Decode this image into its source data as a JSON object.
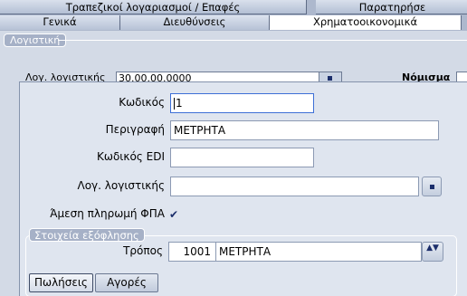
{
  "top_tabs": [
    "Τραπεζικοί λογαριασμοί / Επαφές",
    "Παρατηρήσε"
  ],
  "sub_tabs": [
    "Γενικά",
    "Διευθύνσεις",
    "Χρηματοοικονομικά"
  ],
  "active_sub_tab": "Χρηματοοικονομικά",
  "section_caption": "Λογιστική",
  "bg_account": {
    "label": "Λογ. λογιστικής",
    "value": "30.00.00.0000",
    "right_label": "Νόμισμα"
  },
  "popup": {
    "code": {
      "label": "Κωδικός",
      "value": "1"
    },
    "description": {
      "label": "Περιγραφή",
      "value": "ΜΕΤΡΗΤΑ"
    },
    "edi_code": {
      "label": "Κωδικός EDI",
      "value": ""
    },
    "account": {
      "label": "Λογ. λογιστικής",
      "value": ""
    },
    "vat_direct": {
      "label": "Άμεση πληρωμή ΦΠΑ",
      "checked": true,
      "check_glyph": "✔"
    },
    "group_caption": "Στοιχεία εξόφλησης",
    "method": {
      "label": "Τρόπος",
      "code": "1001",
      "text": "ΜΕΤΡΗΤΑ",
      "arrow_glyph": "▲▼"
    },
    "tabs": [
      "Πωλήσεις",
      "Αγορές"
    ],
    "active_tab": "Πωλήσεις"
  },
  "colors": {
    "tab_bar": "#adb8cd",
    "panel": "#d3dae6",
    "popup": "#dfe5ef",
    "focus_border": "#3d6fd6",
    "button_glyph": "#1b2e6b"
  }
}
